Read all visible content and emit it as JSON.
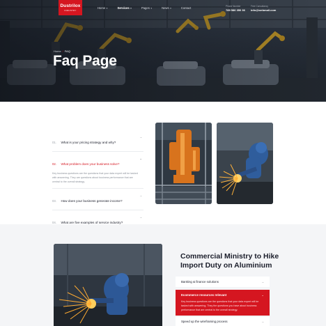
{
  "brand": {
    "name": "Dustrilox",
    "tagline": "INDUSTRY",
    "accent": "#d51620"
  },
  "nav": {
    "items": [
      {
        "label": "Home",
        "has_dropdown": true,
        "active": false
      },
      {
        "label": "Services",
        "has_dropdown": true,
        "active": true
      },
      {
        "label": "Pages",
        "has_dropdown": true,
        "active": false
      },
      {
        "label": "News",
        "has_dropdown": true,
        "active": false
      },
      {
        "label": "Contact",
        "has_dropdown": false,
        "active": false
      }
    ],
    "phone_label": "Phone Number",
    "phone": "789 586 350 36",
    "email_label": "Free Consultancy",
    "email": "info@webmail.com"
  },
  "hero": {
    "breadcrumb": {
      "home": "Home",
      "separator": "/",
      "current": "FAQ"
    },
    "title": "Faq Page"
  },
  "faq": {
    "items": [
      {
        "num": "01.",
        "question": "What is your pricing strategy and why?",
        "open": false
      },
      {
        "num": "02.",
        "question": "What problem does your business solve?",
        "open": true,
        "answer": "Key business questions are the questions that your data expert will be tasked with answering. They are questions about business performance that are central to the overall strategy."
      },
      {
        "num": "03.",
        "question": "How does your business generate income?",
        "open": false
      },
      {
        "num": "04.",
        "question": "What are five examples of service industry?",
        "open": false
      }
    ]
  },
  "section2": {
    "heading": "Commercial Ministry to Hike Import Duty on Aluminium",
    "accordion": [
      {
        "title": "Banking & finance solutions",
        "active": false
      },
      {
        "title": "Ecommerce resources relevant",
        "active": true,
        "answer": "Key business questions are the questions that your data expert will be tasked with answering. They the questions you have about business performance that are central to the overall strategy."
      },
      {
        "title": "Speed up the wireframing process",
        "active": false
      }
    ]
  },
  "icons": {
    "dropdown": "chevron-down-icon",
    "collapsed": "arrow-right-icon",
    "expanded": "chevron-down-icon"
  }
}
